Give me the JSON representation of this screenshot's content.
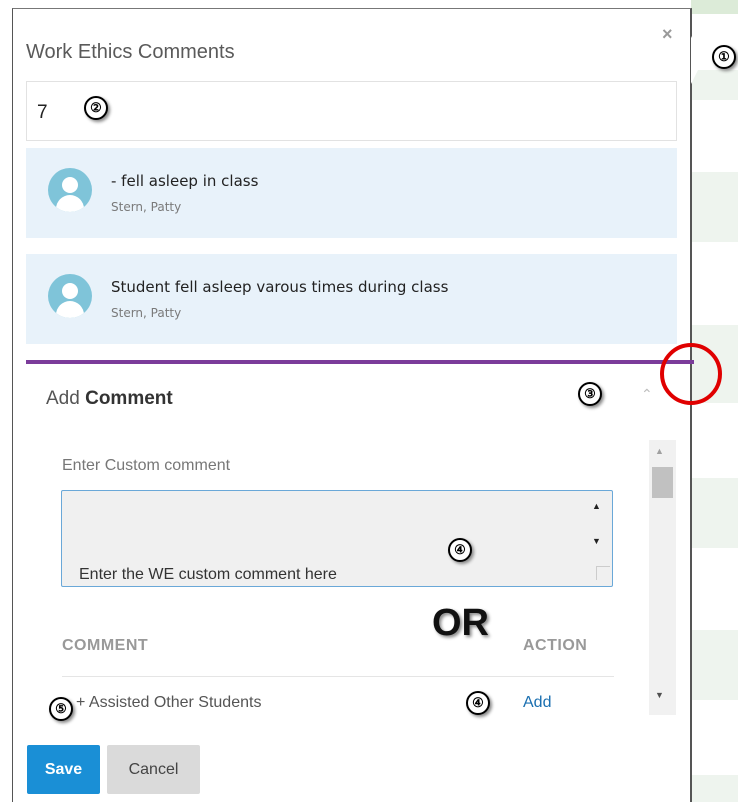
{
  "dialog": {
    "title": "Work Ethics Comments",
    "close_icon": "×",
    "comment_count": "7"
  },
  "comments": [
    {
      "text": "- fell asleep in class",
      "author": "Stern, Patty"
    },
    {
      "text": "Student fell asleep varous times during class",
      "author": "Stern, Patty"
    }
  ],
  "add_comment": {
    "header_prefix": "Add ",
    "header_bold": "Comment",
    "custom_label": "Enter Custom comment",
    "textarea_value": "Enter the WE custom comment here",
    "or_label": "OR",
    "columns": {
      "comment": "COMMENT",
      "action": "ACTION"
    },
    "rows": [
      {
        "label": "+ Assisted Other Students",
        "action": "Add"
      }
    ]
  },
  "buttons": {
    "save": "Save",
    "cancel": "Cancel"
  },
  "annotations": [
    "①",
    "②",
    "③",
    "④",
    "④",
    "⑤"
  ],
  "colors": {
    "accent": "#1a8fd6",
    "divider": "#7b3c9a",
    "card_bg": "#e8f2fa",
    "highlight": "#e00000"
  }
}
